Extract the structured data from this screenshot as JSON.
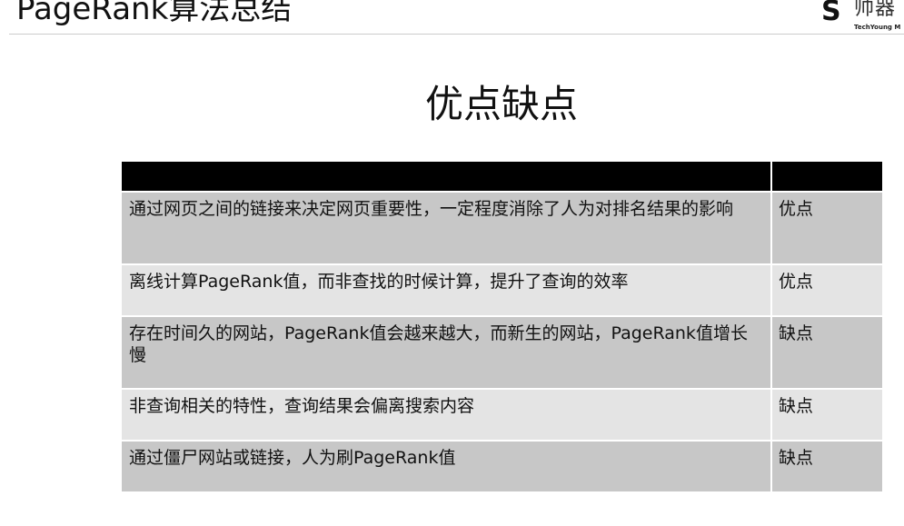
{
  "header": {
    "title": "PageRank算法总结",
    "logo": {
      "mark": "S",
      "name_cn": "帅器",
      "name_en": "TechYoung M"
    }
  },
  "section": {
    "title": "优点缺点"
  },
  "table": {
    "header": [
      "",
      ""
    ],
    "rows": [
      {
        "description": "通过网页之间的链接来决定网页重要性，一定程度消除了人为对排名结果的影响",
        "type": "优点"
      },
      {
        "description": "离线计算PageRank值，而非查找的时候计算，提升了查询的效率",
        "type": "优点"
      },
      {
        "description": "存在时间久的网站，PageRank值会越来越大，而新生的网站，PageRank值增长慢",
        "type": "缺点"
      },
      {
        "description": "非查询相关的特性，查询结果会偏离搜索内容",
        "type": "缺点"
      },
      {
        "description": "通过僵尸网站或链接，人为刷PageRank值",
        "type": "缺点"
      }
    ]
  },
  "colors": {
    "table_header": "#000000",
    "row_dark": "#c7c7c7",
    "row_light": "#e4e4e4",
    "text": "#111111"
  }
}
